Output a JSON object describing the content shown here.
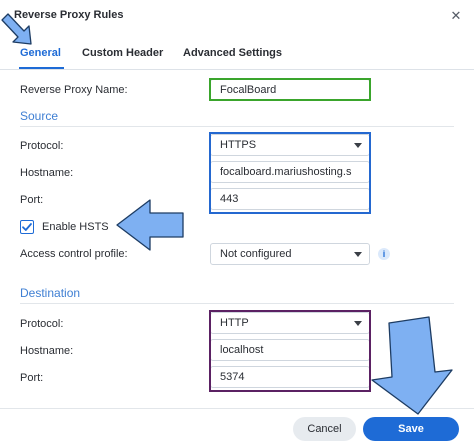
{
  "dialog": {
    "title": "Reverse Proxy Rules",
    "close_glyph": "✕"
  },
  "tabs": [
    {
      "label": "General",
      "active": true
    },
    {
      "label": "Custom Header",
      "active": false
    },
    {
      "label": "Advanced Settings",
      "active": false
    }
  ],
  "general": {
    "name_label": "Reverse Proxy Name:",
    "name_value": "FocalBoard"
  },
  "source": {
    "heading": "Source",
    "protocol_label": "Protocol:",
    "protocol_value": "HTTPS",
    "hostname_label": "Hostname:",
    "hostname_value": "focalboard.mariushosting.s",
    "port_label": "Port:",
    "port_value": "443",
    "hsts_label": "Enable HSTS",
    "hsts_checked": true,
    "access_label": "Access control profile:",
    "access_value": "Not configured",
    "info_glyph": "i"
  },
  "destination": {
    "heading": "Destination",
    "protocol_label": "Protocol:",
    "protocol_value": "HTTP",
    "hostname_label": "Hostname:",
    "hostname_value": "localhost",
    "port_label": "Port:",
    "port_value": "5374"
  },
  "footer": {
    "cancel_label": "Cancel",
    "save_label": "Save"
  },
  "colors": {
    "accent": "#1e6bd6",
    "highlight_green": "#3aa52c",
    "highlight_blue": "#2468d0",
    "highlight_purple": "#5b2163",
    "annotation_arrow": "#7eb0f2"
  }
}
